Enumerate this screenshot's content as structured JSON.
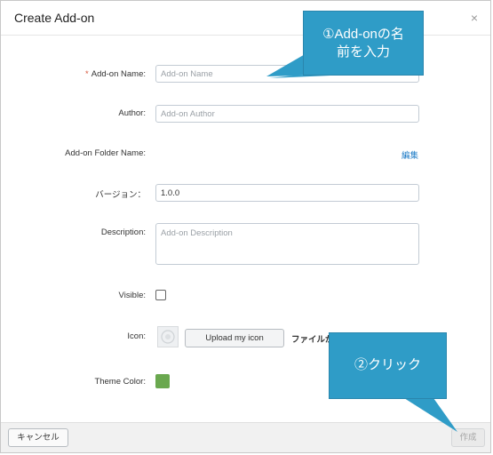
{
  "dialog": {
    "title": "Create Add-on",
    "close_glyph": "×"
  },
  "form": {
    "name": {
      "required_mark": "*",
      "label": "Add-on Name:",
      "placeholder": "Add-on Name"
    },
    "author": {
      "label": "Author:",
      "placeholder": "Add-on Author"
    },
    "folder": {
      "label": "Add-on Folder Name:",
      "edit_link": "編集"
    },
    "version": {
      "label": "バージョン：",
      "value": "1.0.0"
    },
    "description": {
      "label": "Description:",
      "placeholder": "Add-on Description"
    },
    "visible": {
      "label": "Visible:",
      "checked": false
    },
    "icon": {
      "label": "Icon:",
      "upload_label": "Upload my icon",
      "file_status": "ファイルが"
    },
    "theme": {
      "label": "Theme Color:",
      "color": "#6aa84f"
    }
  },
  "footer": {
    "cancel_label": "キャンセル",
    "create_label": "作成"
  },
  "annotations": {
    "callout1_line1": "①Add-onの名",
    "callout1_line2": "前を入力",
    "callout2": "②クリック",
    "color": "#2f9cc7"
  }
}
